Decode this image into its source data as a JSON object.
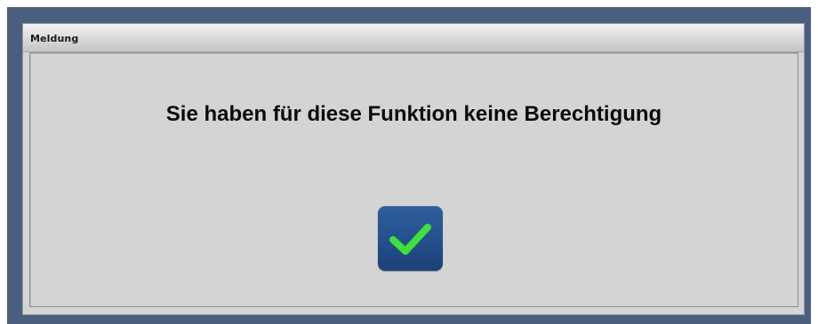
{
  "dialog": {
    "title": "Meldung",
    "message": "Sie haben für diese Funktion keine Berechtigung",
    "confirm_button": {
      "icon": "checkmark-icon",
      "icon_color": "#3ee03a",
      "background_color": "#244f8c"
    }
  },
  "colors": {
    "backdrop": "#4a5f80",
    "dialog_background": "#d4d4d4"
  }
}
